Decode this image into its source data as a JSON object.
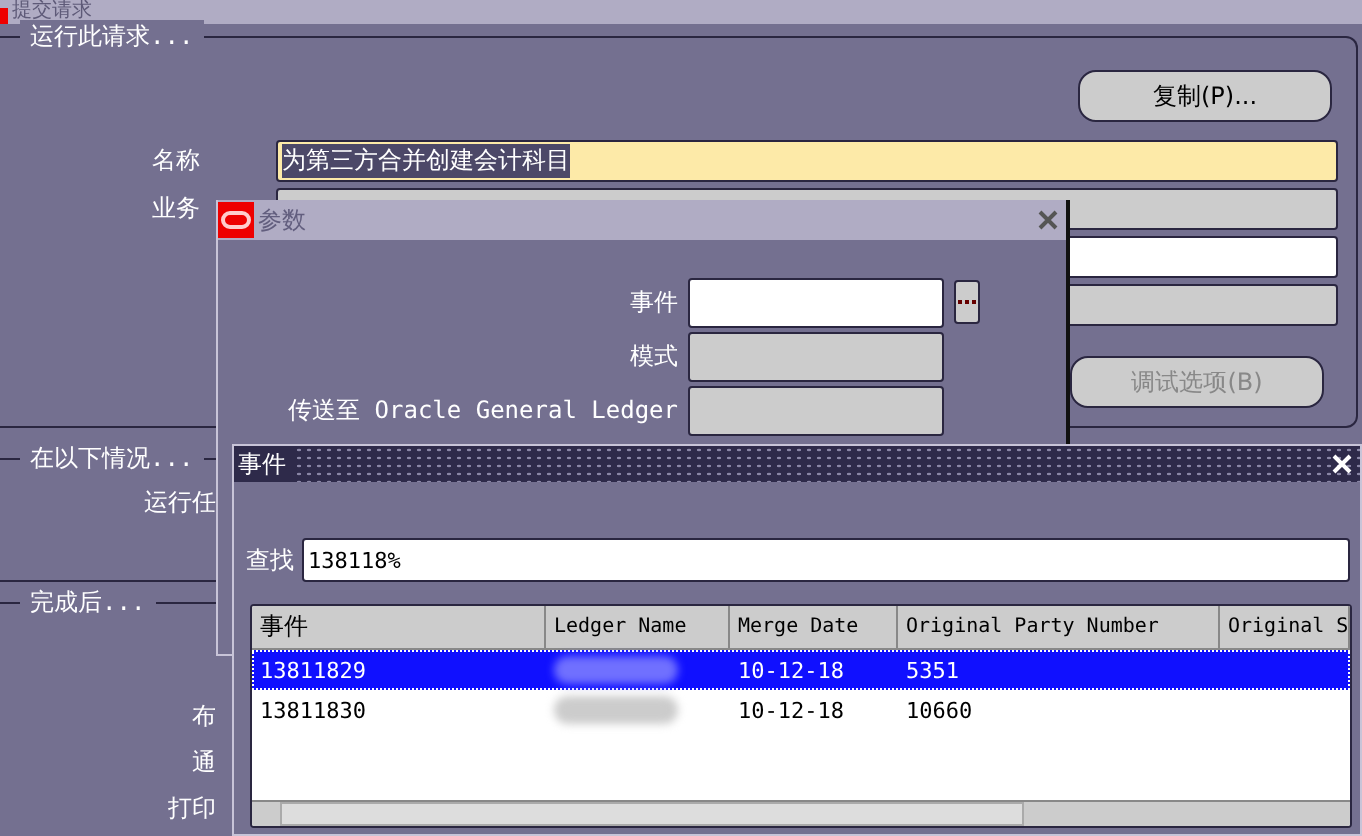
{
  "main_window": {
    "title": "提交请求",
    "run_section": {
      "title": "运行此请求...",
      "copy_button": "复制(P)...",
      "fields": [
        {
          "label": "名称",
          "value": "为第三方合并创建会计科目",
          "kind": "required",
          "selected": true
        },
        {
          "label": "业务",
          "kind": "readonly"
        },
        {
          "kind": "editable"
        },
        {
          "kind": "readonly"
        }
      ],
      "debug_button": {
        "label": "调试选项(B)",
        "disabled": true
      }
    },
    "condition_section": {
      "title": "在以下情况...",
      "labels": [
        "运行任"
      ]
    },
    "completion_section": {
      "title": "完成后...",
      "labels": [
        "布",
        "通",
        "打印"
      ]
    }
  },
  "params_dialog": {
    "title": "参数",
    "fields": [
      {
        "label": "事件",
        "kind": "editable",
        "has_lov": true
      },
      {
        "label": "模式",
        "kind": "readonly",
        "has_lov": false
      },
      {
        "label": "传送至 Oracle General Ledger",
        "kind": "readonly",
        "has_lov": false
      }
    ]
  },
  "list_dialog": {
    "title": "事件",
    "search": {
      "label": "查找",
      "value": "138118%"
    },
    "table": {
      "columns": [
        "事件",
        "Ledger Name",
        "Merge Date",
        "Original Party Number",
        "Original S"
      ],
      "rows": [
        {
          "selected": true,
          "event": "13811829",
          "ledger_redacted": true,
          "merge_date": "10-12-18",
          "party_number": "5351"
        },
        {
          "selected": false,
          "event": "13811830",
          "ledger_redacted": true,
          "merge_date": "10-12-18",
          "party_number": "10660"
        }
      ]
    }
  }
}
